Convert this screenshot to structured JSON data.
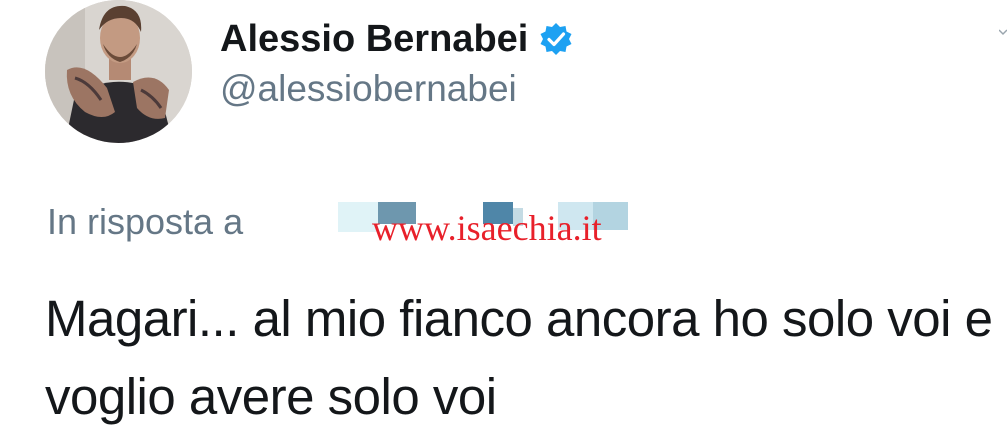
{
  "tweet": {
    "author": {
      "display_name": "Alessio Bernabei",
      "handle": "@alessiobernabei",
      "verified": true,
      "verified_icon": "verified-badge-icon",
      "avatar_icon": "profile-photo"
    },
    "reply": {
      "label": "In risposta a"
    },
    "watermark": "www.isaechia.it",
    "text": "Magari... al mio fianco ancora ho solo voi e voglio avere solo voi"
  },
  "colors": {
    "name": "#14171a",
    "handle": "#657786",
    "verified": "#1da1f2",
    "watermark": "#e8202a"
  }
}
